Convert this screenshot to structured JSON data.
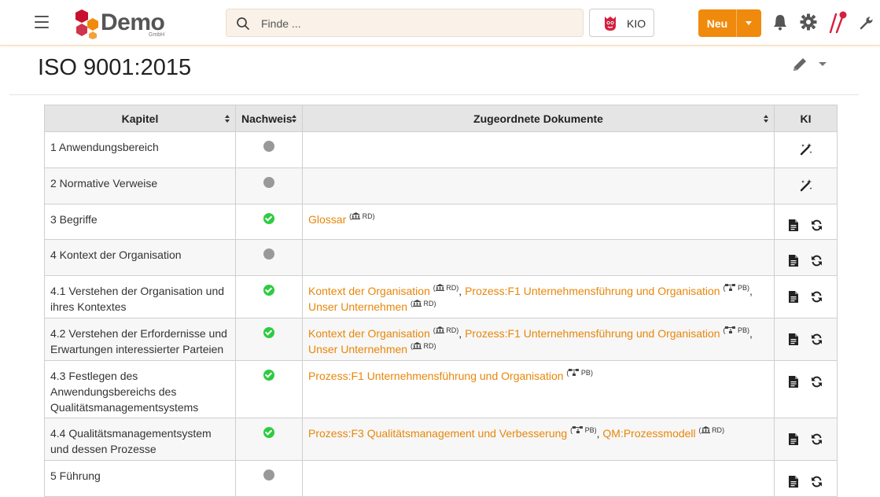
{
  "header": {
    "logo_text": "Demo",
    "logo_sub": "GmbH",
    "search_placeholder": "Finde ...",
    "kio_label": "KIO",
    "new_label": "Neu"
  },
  "page": {
    "title": "ISO 9001:2015"
  },
  "colors": {
    "accent": "#f08a0c",
    "link": "#e8860a",
    "status_ok": "#2ecc40",
    "status_none": "#999999"
  },
  "table": {
    "columns": [
      "Kapitel",
      "Nachweis",
      "Zugeordnete Dokumente",
      "KI"
    ],
    "rows": [
      {
        "kapitel": "1 Anwendungsbereich",
        "status": "none",
        "docs": [],
        "ki": "wand"
      },
      {
        "kapitel": "2 Normative Verweise",
        "status": "none",
        "docs": [],
        "ki": "wand"
      },
      {
        "kapitel": "3 Begriffe",
        "status": "ok",
        "docs": [
          {
            "name": "Glossar",
            "tag": "RD",
            "icon": "bank-icon"
          }
        ],
        "ki": "doc-refresh"
      },
      {
        "kapitel": "4 Kontext der Organisation",
        "status": "none",
        "docs": [],
        "ki": "doc-refresh"
      },
      {
        "kapitel": "4.1 Verstehen der Organisation und ihres Kontextes",
        "status": "ok",
        "docs": [
          {
            "name": "Kontext der Organisation",
            "tag": "RD",
            "icon": "bank-icon"
          },
          {
            "name": "Prozess:F1 Unternehmensführung und Organisation",
            "tag": "PB",
            "icon": "process-icon"
          },
          {
            "name": "Unser Unternehmen",
            "tag": "RD",
            "icon": "bank-icon"
          }
        ],
        "ki": "doc-refresh"
      },
      {
        "kapitel": "4.2 Verstehen der Erfordernisse und Erwartungen interessierter Parteien",
        "status": "ok",
        "docs": [
          {
            "name": "Kontext der Organisation",
            "tag": "RD",
            "icon": "bank-icon"
          },
          {
            "name": "Prozess:F1 Unternehmensführung und Organisation",
            "tag": "PB",
            "icon": "process-icon"
          },
          {
            "name": "Unser Unternehmen",
            "tag": "RD",
            "icon": "bank-icon"
          }
        ],
        "ki": "doc-refresh"
      },
      {
        "kapitel": "4.3 Festlegen des Anwendungsbereichs des Qualitätsmanagementsystems",
        "status": "ok",
        "docs": [
          {
            "name": "Prozess:F1 Unternehmensführung und Organisation",
            "tag": "PB",
            "icon": "process-icon"
          }
        ],
        "ki": "doc-refresh"
      },
      {
        "kapitel": "4.4 Qualitätsmanagementsystem und dessen Prozesse",
        "status": "ok",
        "docs": [
          {
            "name": "Prozess:F3 Qualitätsmanagement und Verbesserung",
            "tag": "PB",
            "icon": "process-icon"
          },
          {
            "name": "QM:Prozessmodell",
            "tag": "RD",
            "icon": "bank-icon"
          }
        ],
        "ki": "doc-refresh"
      },
      {
        "kapitel": "5 Führung",
        "status": "none",
        "docs": [],
        "ki": "doc-refresh"
      }
    ]
  }
}
